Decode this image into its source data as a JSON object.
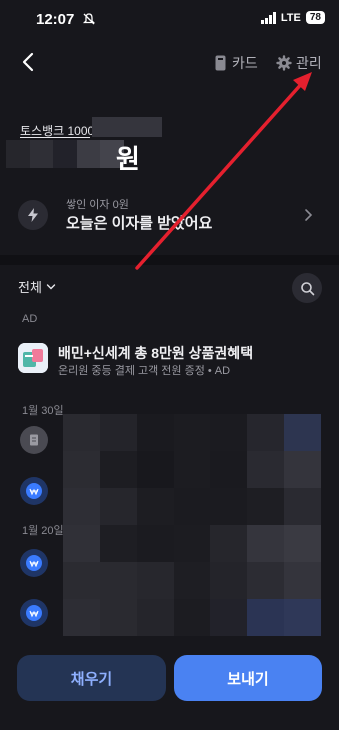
{
  "status_bar": {
    "time": "12:07",
    "network": "LTE",
    "battery": "78"
  },
  "header": {
    "card_label": "카드",
    "manage_label": "관리"
  },
  "account": {
    "name": "토스뱅크 1000-",
    "balance_unit": "원"
  },
  "interest": {
    "small": "쌓인 이자 0원",
    "main": "오늘은 이자를 받았어요"
  },
  "filter": {
    "label": "전체"
  },
  "ad": {
    "tag": "AD",
    "title": "배민+신세계 총 8만원 상품권혜택",
    "subtitle": "온리원 중등 결제 고객 전원 증정 • AD"
  },
  "dates": [
    "1월 30일",
    "1월 20일"
  ],
  "buttons": {
    "fill": "채우기",
    "send": "보내기"
  },
  "colors": {
    "background": "#17171c",
    "accent": "#4a82f2",
    "annotation": "#e5202e"
  }
}
